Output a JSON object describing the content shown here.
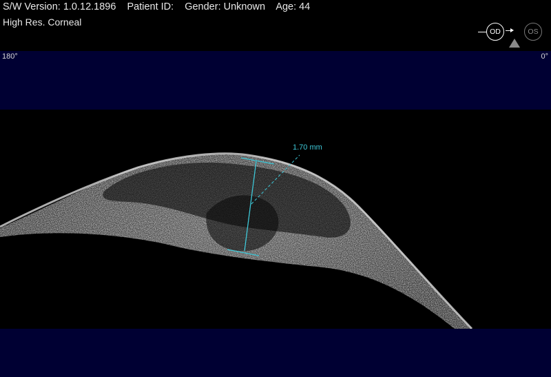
{
  "header": {
    "sw_version": "S/W Version: 1.0.12.1896",
    "patient_id": "Patient ID:",
    "gender": "Gender: Unknown",
    "age": "Age: 44",
    "scan_mode": "High Res. Corneal"
  },
  "eye_selector": {
    "od_label": "OD",
    "os_label": "OS",
    "selected": "OD"
  },
  "angles": {
    "left": "180°",
    "right": "0°"
  },
  "measurement": {
    "label": "1.70 mm",
    "color": "#3ec8d8"
  },
  "colors": {
    "band": "#000033",
    "background": "#000000"
  }
}
